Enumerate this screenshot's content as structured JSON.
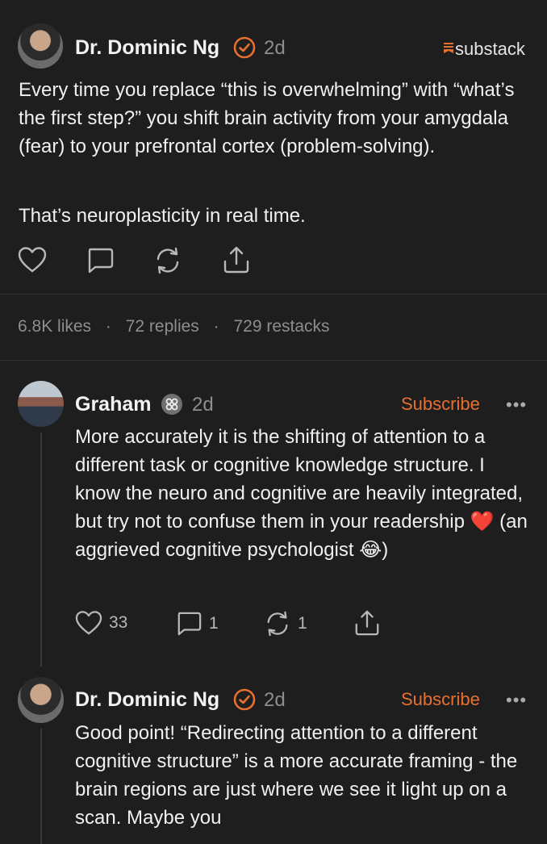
{
  "post": {
    "author": "Dr. Dominic Ng",
    "time": "2d",
    "brand": "substack",
    "paragraph1": "Every time you replace “this is overwhelming” with “what’s the first step?” you shift brain activity from your amygdala (fear) to your prefrontal cortex (problem-solving).",
    "paragraph2": "That’s neuroplasticity in real time.",
    "stats": {
      "likes": "6.8K likes",
      "sep1": "·",
      "replies": "72 replies",
      "sep2": "·",
      "restacks": "729 restacks"
    }
  },
  "comments": [
    {
      "author": "Graham",
      "time": "2d",
      "subscribe": "Subscribe",
      "more": "•••",
      "text_a": "More accurately it is the shifting of attention to a different task or cognitive knowledge structure.  I know the neuro and cognitive are heavily integrated, but try not to confuse them in your readership ",
      "emoji1": "❤️",
      "text_b": " (an aggrieved cognitive psychologist ",
      "emoji2": "😂",
      "text_c": ")",
      "likes": "33",
      "replies": "1",
      "restacks": "1"
    },
    {
      "author": "Dr. Dominic Ng",
      "time": "2d",
      "subscribe": "Subscribe",
      "more": "•••",
      "text": "Good point! “Redirecting attention to a different cognitive structure” is a more accurate framing - the brain regions are just where we see it light up on a scan. Maybe you"
    }
  ],
  "colors": {
    "background": "#1e1e1e",
    "accent": "#e8702f",
    "muted": "#8e8e8e"
  },
  "icons": [
    "verified-badge-icon",
    "heart-icon",
    "comment-icon",
    "restack-icon",
    "share-icon",
    "founding-badge-icon",
    "substack-logo-icon"
  ]
}
